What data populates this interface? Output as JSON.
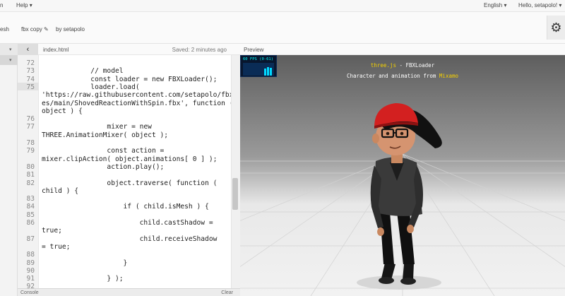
{
  "nav": {
    "left_menu_fragment": "n",
    "help": "Help",
    "language": "English",
    "greeting": "Hello, setapolo!"
  },
  "project": {
    "refresh_fragment": "esh",
    "title": "fbx copy",
    "author": "by setapolo"
  },
  "editor": {
    "filename": "index.html",
    "saved": "Saved: 2 minutes ago",
    "lines": [
      {
        "num": "72",
        "text": ""
      },
      {
        "num": "73",
        "text": "            // model"
      },
      {
        "num": "74",
        "text": "            const loader = new FBXLoader();"
      },
      {
        "num": "75",
        "text": "            loader.load("
      },
      {
        "num": "",
        "text": "'https://raw.githubusercontent.com/setapolo/fbx"
      },
      {
        "num": "",
        "text": "es/main/ShovedReactionWithSpin.fbx', function ("
      },
      {
        "num": "",
        "text": "object ) {"
      },
      {
        "num": "76",
        "text": ""
      },
      {
        "num": "77",
        "text": "                mixer = new"
      },
      {
        "num": "",
        "text": "THREE.AnimationMixer( object );"
      },
      {
        "num": "78",
        "text": ""
      },
      {
        "num": "79",
        "text": "                const action ="
      },
      {
        "num": "",
        "text": "mixer.clipAction( object.animations[ 0 ] );"
      },
      {
        "num": "80",
        "text": "                action.play();"
      },
      {
        "num": "81",
        "text": ""
      },
      {
        "num": "82",
        "text": "                object.traverse( function ("
      },
      {
        "num": "",
        "text": "child ) {"
      },
      {
        "num": "83",
        "text": ""
      },
      {
        "num": "84",
        "text": "                    if ( child.isMesh ) {"
      },
      {
        "num": "85",
        "text": ""
      },
      {
        "num": "86",
        "text": "                        child.castShadow ="
      },
      {
        "num": "",
        "text": "true;"
      },
      {
        "num": "87",
        "text": "                        child.receiveShadow"
      },
      {
        "num": "",
        "text": "= true;"
      },
      {
        "num": "88",
        "text": ""
      },
      {
        "num": "89",
        "text": "                    }"
      },
      {
        "num": "90",
        "text": ""
      },
      {
        "num": "91",
        "text": "                } );"
      },
      {
        "num": "92",
        "text": ""
      }
    ]
  },
  "console": {
    "label": "Console",
    "clear": "Clear"
  },
  "preview": {
    "header": "Preview",
    "fps_label": "60 FPS (0-61)",
    "info_link": "three.js",
    "info_title_rest": " - FBXLoader",
    "info_sub": "Character and animation from ",
    "info_sub_link": "Mixamo"
  },
  "colors": {
    "link_yellow": "#f5d000",
    "fps_cyan": "#00d8ff",
    "hat_red": "#d32020"
  }
}
